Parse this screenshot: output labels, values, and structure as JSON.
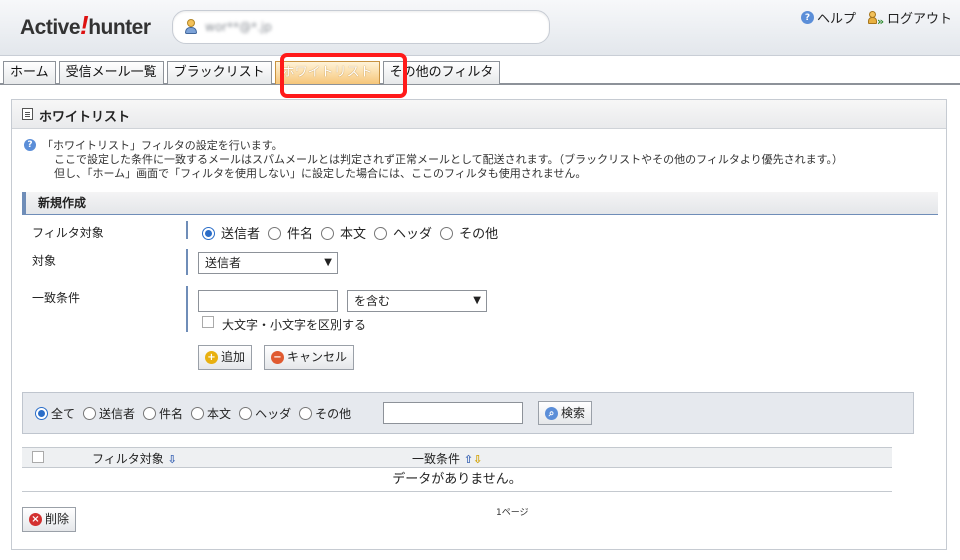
{
  "header": {
    "logo_before": "Active",
    "logo_bang": "!",
    "logo_after": "hunter",
    "username": "wor**@*.jp",
    "help_label": "ヘルプ",
    "help_icon": "question-circle-icon",
    "logout_label": "ログアウト",
    "logout_icon": "user-exit-icon"
  },
  "tabs": [
    {
      "label": "ホーム",
      "active": false
    },
    {
      "label": "受信メール一覧",
      "active": false
    },
    {
      "label": "ブラックリスト",
      "active": false
    },
    {
      "label": "ホワイトリスト",
      "active": true
    },
    {
      "label": "その他のフィルタ",
      "active": false
    }
  ],
  "panel": {
    "title": "ホワイトリスト",
    "desc_line1": "「ホワイトリスト」フィルタの設定を行います。",
    "desc_line2": "ここで設定した条件に一致するメールはスパムメールとは判定されず正常メールとして配送されます。（ブラックリストやその他のフィルタより優先されます。）",
    "desc_line3": "但し、「ホーム」画面で「フィルタを使用しない」に設定した場合には、ここのフィルタも使用されません。"
  },
  "new_entry": {
    "section_title": "新規作成",
    "filter_target_label": "フィルタ対象",
    "filter_target_options": [
      "送信者",
      "件名",
      "本文",
      "ヘッダ",
      "その他"
    ],
    "filter_target_selected": "送信者",
    "target_label": "対象",
    "target_value": "送信者",
    "match_label": "一致条件",
    "match_input_value": "",
    "match_mode": "を含む",
    "case_sensitive_label": "大文字・小文字を区別する",
    "case_sensitive_checked": false,
    "add_label": "追加",
    "cancel_label": "キャンセル"
  },
  "search": {
    "options": [
      "全て",
      "送信者",
      "件名",
      "本文",
      "ヘッダ",
      "その他"
    ],
    "selected": "全て",
    "query": "",
    "button_label": "検索"
  },
  "table": {
    "col_filter_target": "フィルタ対象",
    "col_match": "一致条件",
    "empty_message": "データがありません。"
  },
  "footer": {
    "delete_label": "削除",
    "page_label": "1ページ"
  },
  "colors": {
    "accent": "#6f8db8",
    "highlight": "#ff1a1a",
    "active_tab": "#f6c67a",
    "add_icon": "#e8b010",
    "cancel_icon": "#e05a30",
    "delete_icon": "#d33030"
  }
}
